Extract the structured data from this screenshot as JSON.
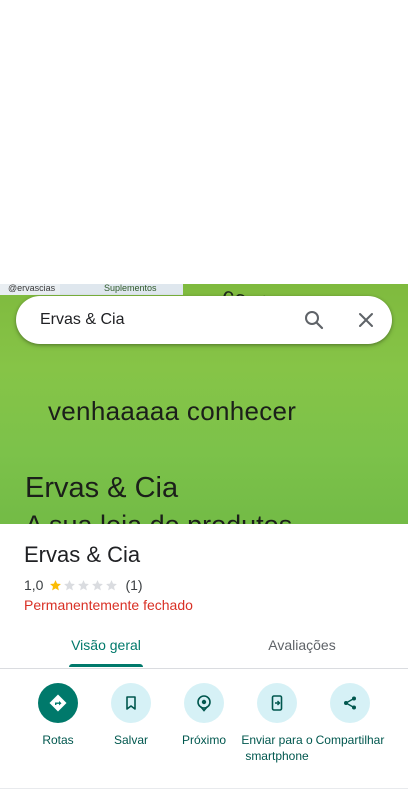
{
  "hero": {
    "handle": "@ervascias",
    "supl": "Suplementos",
    "curve_text": "conhece a l",
    "line1": "venhaaaaa conhecer",
    "line2": "Ervas & Cia",
    "line3": "A sua loja de produtos"
  },
  "search": {
    "query": "Ervas & Cia",
    "search_icon": "search-icon",
    "close_icon": "close-icon"
  },
  "place": {
    "name": "Ervas & Cia",
    "rating": "1,0",
    "stars_filled": 1,
    "stars_total": 5,
    "review_count": "(1)",
    "status": "Permanentemente fechado",
    "status_color": "#d93025",
    "star_color": "#fbbc04"
  },
  "tabs": [
    {
      "label": "Visão geral",
      "active": true
    },
    {
      "label": "Avaliações",
      "active": false
    }
  ],
  "actions": [
    {
      "label": "Rotas",
      "icon": "directions-icon"
    },
    {
      "label": "Salvar",
      "icon": "bookmark-icon"
    },
    {
      "label": "Próximo",
      "icon": "nearby-icon"
    },
    {
      "label": "Enviar para o smartphone",
      "icon": "send-to-phone-icon"
    },
    {
      "label": "Compartilhar",
      "icon": "share-icon"
    }
  ],
  "colors": {
    "accent": "#00796b",
    "chip_bg": "#d6f1f6"
  }
}
